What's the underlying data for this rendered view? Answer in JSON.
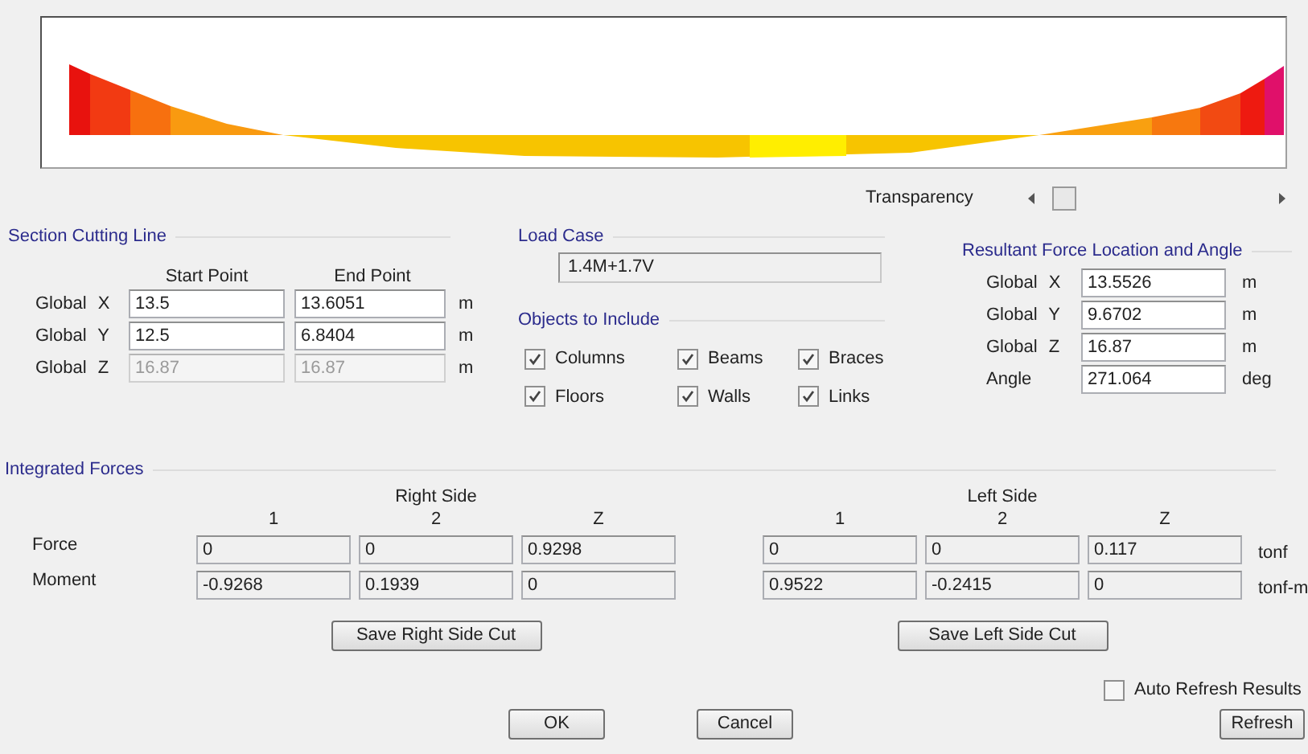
{
  "transparency": {
    "label": "Transparency"
  },
  "section_cutting_line": {
    "title": "Section Cutting Line",
    "columns": [
      "Start Point",
      "End Point"
    ],
    "rows": [
      {
        "label": "Global X",
        "start": "13.5",
        "end": "13.6051",
        "unit": "m",
        "disabled": false
      },
      {
        "label": "Global Y",
        "start": "12.5",
        "end": "6.8404",
        "unit": "m",
        "disabled": false
      },
      {
        "label": "Global Z",
        "start": "16.87",
        "end": "16.87",
        "unit": "m",
        "disabled": true
      }
    ]
  },
  "load_case": {
    "title": "Load Case",
    "value": "1.4M+1.7V"
  },
  "objects_to_include": {
    "title": "Objects to Include",
    "items": [
      {
        "label": "Columns",
        "checked": true
      },
      {
        "label": "Beams",
        "checked": true
      },
      {
        "label": "Braces",
        "checked": true
      },
      {
        "label": "Floors",
        "checked": true
      },
      {
        "label": "Walls",
        "checked": true
      },
      {
        "label": "Links",
        "checked": true
      }
    ]
  },
  "resultant": {
    "title": "Resultant Force Location and Angle",
    "rows": [
      {
        "label": "Global X",
        "value": "13.5526",
        "unit": "m"
      },
      {
        "label": "Global Y",
        "value": "9.6702",
        "unit": "m"
      },
      {
        "label": "Global Z",
        "value": "16.87",
        "unit": "m"
      },
      {
        "label": "Angle",
        "value": "271.064",
        "unit": "deg"
      }
    ]
  },
  "integrated_forces": {
    "title": "Integrated Forces",
    "row_labels": [
      "Force",
      "Moment"
    ],
    "units": [
      "tonf",
      "tonf-m"
    ],
    "sides": [
      {
        "title": "Right Side",
        "columns": [
          "1",
          "2",
          "Z"
        ],
        "rows": [
          [
            "0",
            "0",
            "0.9298"
          ],
          [
            "-0.9268",
            "0.1939",
            "0"
          ]
        ],
        "button": "Save Right Side Cut"
      },
      {
        "title": "Left Side",
        "columns": [
          "1",
          "2",
          "Z"
        ],
        "rows": [
          [
            "0",
            "0",
            "0.117"
          ],
          [
            "0.9522",
            "-0.2415",
            "0"
          ]
        ],
        "button": "Save Left Side Cut"
      }
    ]
  },
  "auto_refresh": {
    "label": "Auto Refresh Results",
    "checked": false
  },
  "buttons": [
    {
      "label": "OK"
    },
    {
      "label": "Cancel"
    }
  ],
  "refresh_button": {
    "label": "Refresh"
  }
}
